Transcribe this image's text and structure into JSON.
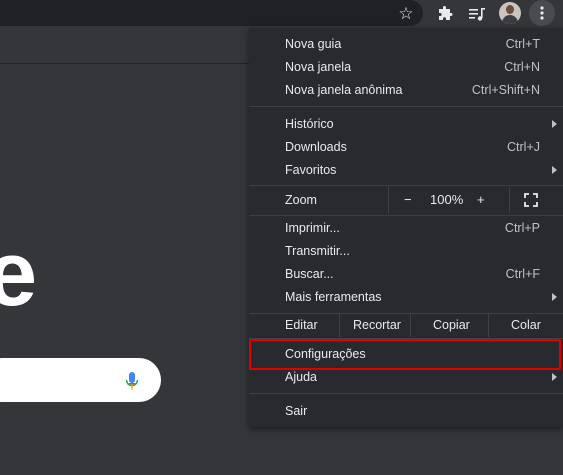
{
  "toolbar": {
    "star_icon": "star-icon",
    "extensions_icon": "puzzle-icon",
    "media_icon": "media-control-icon",
    "avatar": "profile-avatar",
    "menu_icon": "kebab-menu-icon"
  },
  "page": {
    "logo_fragment": "e"
  },
  "menu": {
    "new_tab": {
      "label": "Nova guia",
      "shortcut": "Ctrl+T"
    },
    "new_window": {
      "label": "Nova janela",
      "shortcut": "Ctrl+N"
    },
    "incognito": {
      "label": "Nova janela anônima",
      "shortcut": "Ctrl+Shift+N"
    },
    "history": {
      "label": "Histórico"
    },
    "downloads": {
      "label": "Downloads",
      "shortcut": "Ctrl+J"
    },
    "bookmarks": {
      "label": "Favoritos"
    },
    "zoom": {
      "label": "Zoom",
      "minus": "−",
      "value": "100%",
      "plus": "+"
    },
    "print": {
      "label": "Imprimir...",
      "shortcut": "Ctrl+P"
    },
    "cast": {
      "label": "Transmitir..."
    },
    "find": {
      "label": "Buscar...",
      "shortcut": "Ctrl+F"
    },
    "more_tools": {
      "label": "Mais ferramentas"
    },
    "edit": {
      "label": "Editar",
      "cut": "Recortar",
      "copy": "Copiar",
      "paste": "Colar"
    },
    "settings": {
      "label": "Configurações"
    },
    "help": {
      "label": "Ajuda"
    },
    "exit": {
      "label": "Sair"
    }
  },
  "colors": {
    "menu_bg": "#292a2d",
    "highlight": "#e00000",
    "mic_blue": "#4285f4",
    "mic_red": "#ea4335"
  }
}
